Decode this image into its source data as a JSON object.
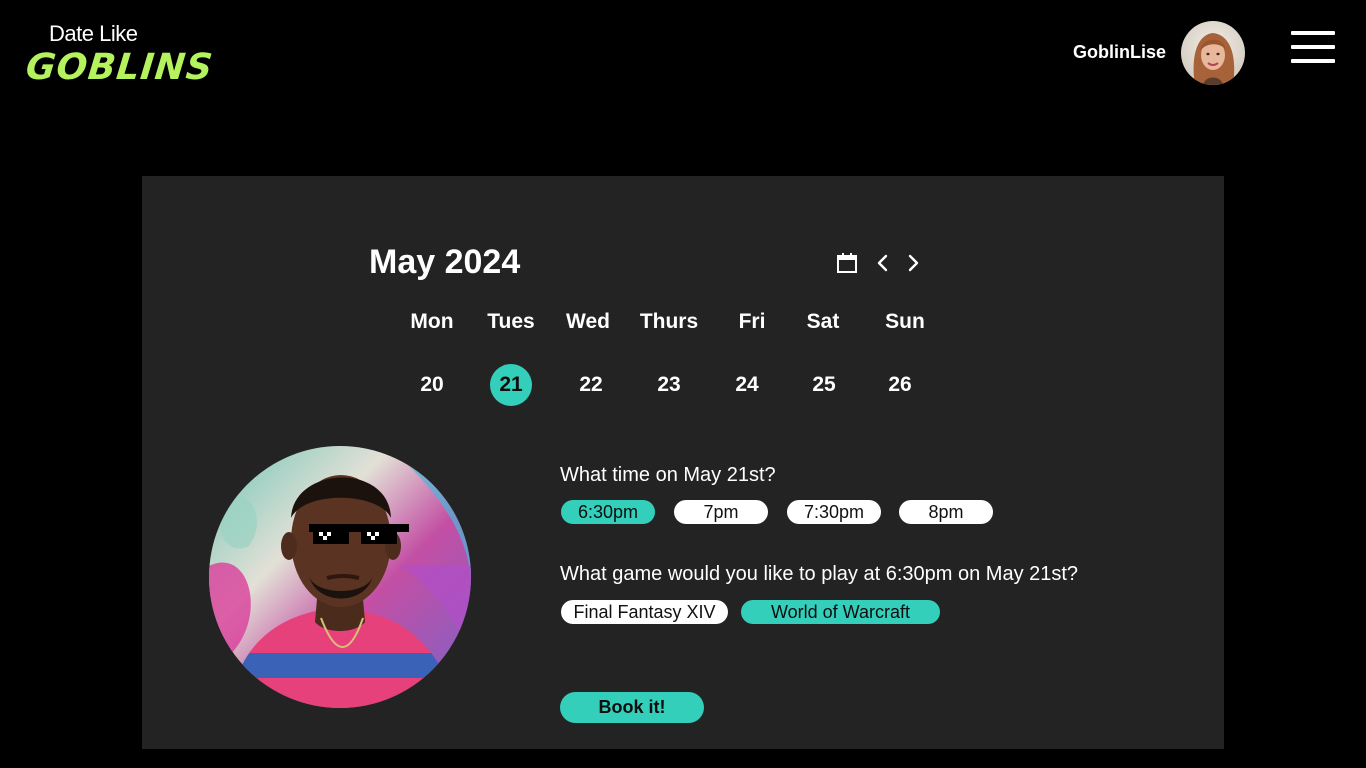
{
  "app": {
    "logo_top": "Date Like",
    "logo_bottom": "GOBLINS"
  },
  "header": {
    "username": "GoblinLise",
    "avatar_icon": "user-avatar-photo",
    "menu_icon": "hamburger-menu-icon"
  },
  "calendar": {
    "month_title": "May 2024",
    "calendar_icon": "calendar-icon",
    "prev_icon": "chevron-left-icon",
    "next_icon": "chevron-right-icon",
    "day_names": [
      "Mon",
      "Tues",
      "Wed",
      "Thurs",
      "Fri",
      "Sat",
      "Sun"
    ],
    "day_numbers": [
      "20",
      "21",
      "22",
      "23",
      "24",
      "25",
      "26"
    ],
    "selected_day": "21"
  },
  "booking": {
    "time_question": "What time on May 21st?",
    "times": [
      {
        "label": "6:30pm",
        "selected": true
      },
      {
        "label": "7pm",
        "selected": false
      },
      {
        "label": "7:30pm",
        "selected": false
      },
      {
        "label": "8pm",
        "selected": false
      }
    ],
    "game_question": "What game would you like to play at 6:30pm on May 21st?",
    "games": [
      {
        "label": "Final Fantasy XIV",
        "selected": false
      },
      {
        "label": "World of Warcraft",
        "selected": true
      }
    ],
    "book_label": "Book it!"
  },
  "colors": {
    "accent": "#33cfbb",
    "logo_green": "#b4f25e",
    "panel_bg": "#232323",
    "page_bg": "#000000"
  }
}
